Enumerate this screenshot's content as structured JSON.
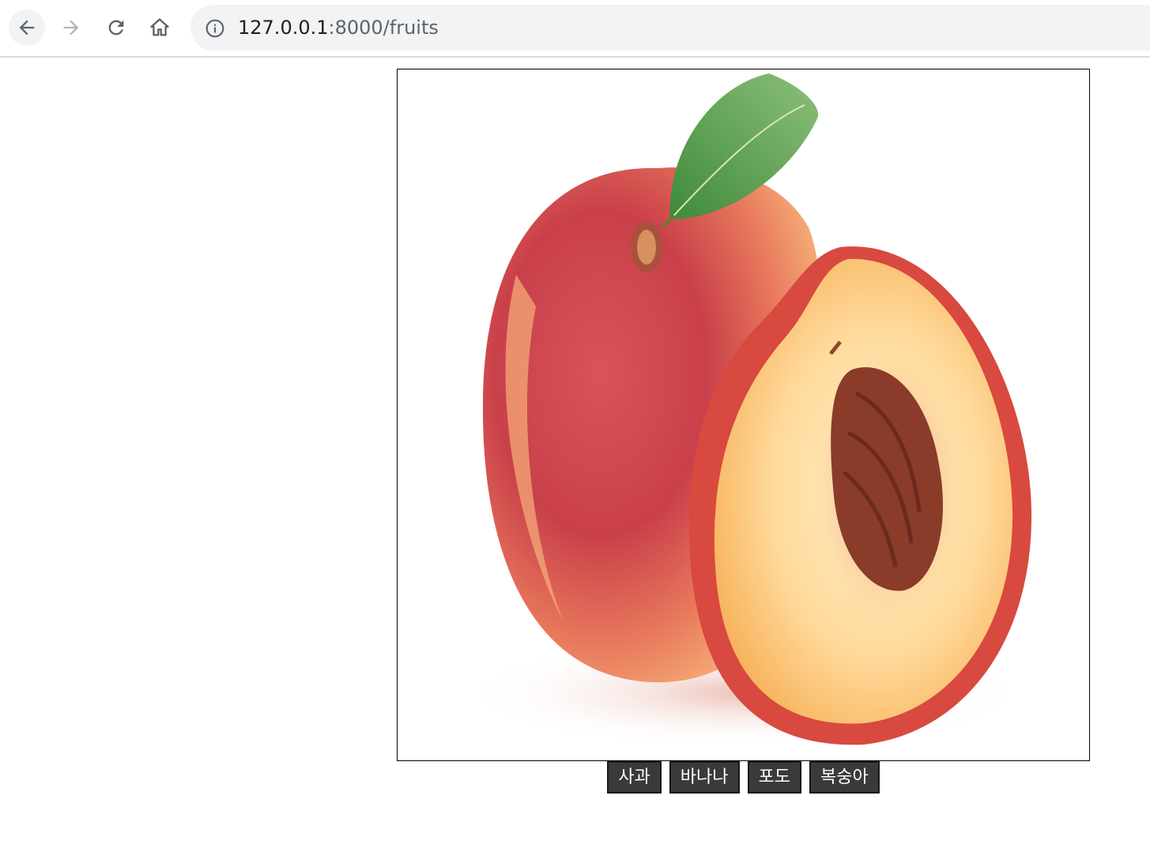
{
  "browser": {
    "url_host": "127.0.0.1",
    "url_path": ":8000/fruits"
  },
  "main": {
    "image_alt": "peach-image",
    "buttons": [
      {
        "label": "사과"
      },
      {
        "label": "바나나"
      },
      {
        "label": "포도"
      },
      {
        "label": "복숭아"
      }
    ]
  },
  "colors": {
    "button_bg": "#3a3a3a",
    "button_text": "#ffffff"
  }
}
